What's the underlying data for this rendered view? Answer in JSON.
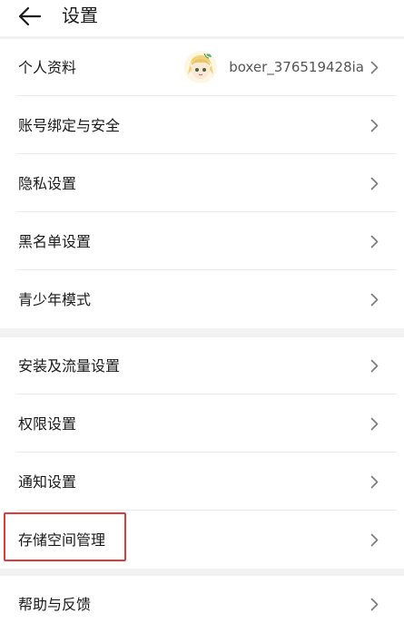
{
  "header": {
    "title": "设置",
    "back_icon": "arrow-left-icon"
  },
  "profile": {
    "label": "个人资料",
    "username": "boxer_376519428ia",
    "avatar_icon": "anime-avatar"
  },
  "group1": [
    {
      "key": "account",
      "label": "账号绑定与安全"
    },
    {
      "key": "privacy",
      "label": "隐私设置"
    },
    {
      "key": "blacklist",
      "label": "黑名单设置"
    },
    {
      "key": "teen",
      "label": "青少年模式"
    }
  ],
  "group2": [
    {
      "key": "install",
      "label": "安装及流量设置"
    },
    {
      "key": "permission",
      "label": "权限设置"
    },
    {
      "key": "notification",
      "label": "通知设置"
    },
    {
      "key": "storage",
      "label": "存储空间管理"
    }
  ],
  "group3": [
    {
      "key": "help",
      "label": "帮助与反馈"
    }
  ],
  "colors": {
    "highlight": "#e03a3a",
    "separator": "#f2f2f2",
    "chevron": "#7a7a7a"
  }
}
